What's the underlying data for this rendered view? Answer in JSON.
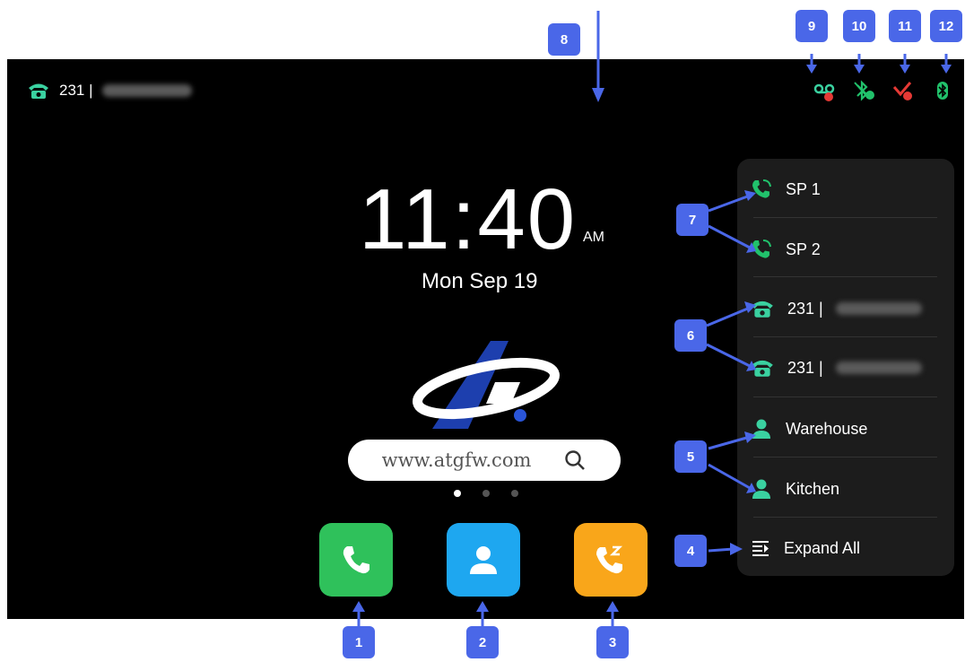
{
  "statusbar": {
    "line_label": "231 |",
    "icons": [
      "voicemail-icon",
      "bluetooth-off-icon",
      "missed-call-icon",
      "bluetooth-icon"
    ]
  },
  "clock": {
    "time": "11:40",
    "ampm": "AM",
    "date": "Mon Sep 19"
  },
  "search": {
    "text": "www.atgfw.com",
    "icon": "search-icon"
  },
  "dock": [
    {
      "name": "phone-app",
      "color": "#2fc15b"
    },
    {
      "name": "contacts-app",
      "color": "#1ea7f0"
    },
    {
      "name": "dnd-call-app",
      "color": "#f9a61a"
    }
  ],
  "panel": {
    "sp1": "SP 1",
    "sp2": "SP 2",
    "line1": "231 |",
    "line2": "231 |",
    "intercom1": "Warehouse",
    "intercom2": "Kitchen",
    "expand": "Expand All"
  },
  "callouts": [
    "1",
    "2",
    "3",
    "4",
    "5",
    "6",
    "7",
    "8",
    "9",
    "10",
    "11",
    "12"
  ],
  "colors": {
    "accent": "#3ad1a0",
    "callout": "#4a67e8",
    "red": "#e53935",
    "green": "#21c16b"
  }
}
